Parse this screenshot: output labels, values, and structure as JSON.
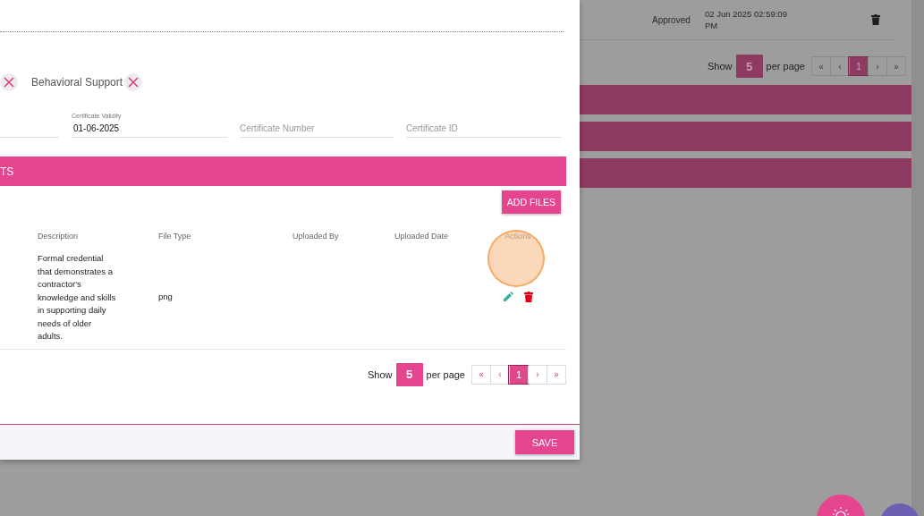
{
  "modal": {
    "chips": [
      {
        "kind": "cut"
      },
      {
        "kind": "full",
        "label": "Behavioral Support"
      }
    ],
    "fields": [
      {
        "kind": "cut"
      },
      {
        "kind": "filled",
        "label": "Certificate Validity",
        "value": "01-06-2025"
      },
      {
        "kind": "empty",
        "placeholder": "Certificate Number"
      },
      {
        "kind": "empty",
        "placeholder": "Certificate ID"
      }
    ],
    "section_title": "TS",
    "add_button": "ADD FILES",
    "table": {
      "columns": [
        "Description",
        "File Type",
        "Uploaded By",
        "Uploaded Date",
        "Actions"
      ],
      "rows": [
        {
          "description": "Formal credential that demonstrates a contractor's knowledge and skills in supporting daily needs of older adults.",
          "file_type": "png"
        }
      ]
    },
    "pager": {
      "show": "Show",
      "size": "5",
      "per_page": "per page",
      "pages": [
        {
          "label": "«",
          "selected": false
        },
        {
          "label": "‹",
          "selected": false
        },
        {
          "label": "1",
          "selected": true
        },
        {
          "label": "›",
          "selected": false
        },
        {
          "label": "»",
          "selected": false
        }
      ]
    },
    "save_button": "SAVE"
  },
  "background": {
    "row": {
      "status": "Approved",
      "date": "02 Jun 2025 02:59:09 PM"
    },
    "pager": {
      "show": "Show",
      "size": "5",
      "per_page": "per page",
      "pages": [
        {
          "label": "«",
          "selected": false
        },
        {
          "label": "‹",
          "selected": false
        },
        {
          "label": "1",
          "selected": true
        },
        {
          "label": "›",
          "selected": false
        },
        {
          "label": "»",
          "selected": false
        }
      ]
    }
  }
}
